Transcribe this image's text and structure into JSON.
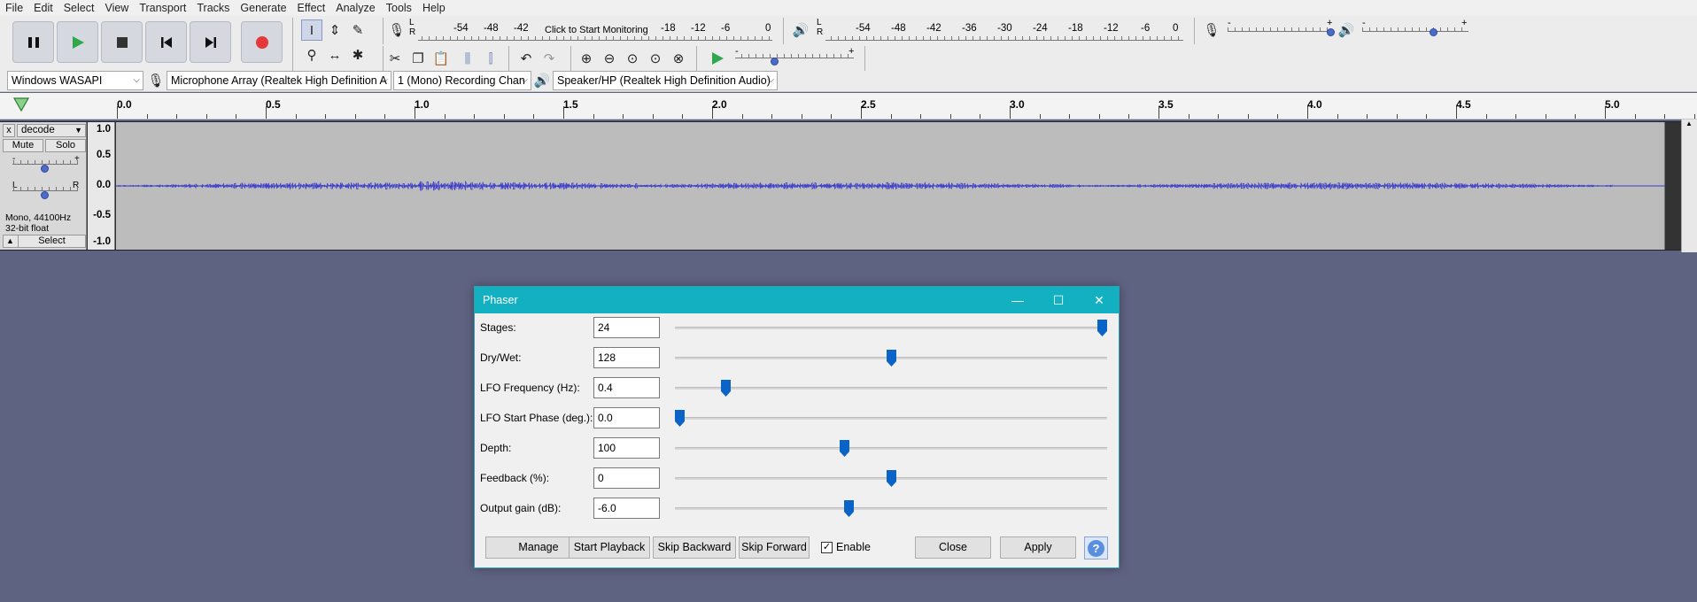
{
  "menu": [
    "File",
    "Edit",
    "Select",
    "View",
    "Transport",
    "Tracks",
    "Generate",
    "Effect",
    "Analyze",
    "Tools",
    "Help"
  ],
  "toolbar": {
    "record_meter": {
      "lr_top": "L",
      "lr_bottom": "R",
      "ticks": [
        "-54",
        "-48",
        "-42",
        "-18",
        "-12",
        "-6",
        "0"
      ],
      "monitor_label": "Click to Start Monitoring"
    },
    "playback_meter": {
      "lr_top": "L",
      "lr_bottom": "R",
      "ticks": [
        "-54",
        "-48",
        "-42",
        "-36",
        "-30",
        "-24",
        "-18",
        "-12",
        "-6",
        "0"
      ]
    },
    "mixer": {
      "minus": "-",
      "plus": "+"
    },
    "play_at_speed": {
      "minus": "-",
      "plus": "+"
    }
  },
  "device": {
    "host": "Windows WASAPI",
    "recording_device": "Microphone Array (Realtek High Definition A",
    "channels": "1 (Mono) Recording Chan",
    "playback_device": "Speaker/HP (Realtek High Definition Audio)"
  },
  "ruler": {
    "labels": [
      "0.0",
      "0.5",
      "1.0",
      "1.5",
      "2.0",
      "2.5",
      "3.0",
      "3.5",
      "4.0",
      "4.5",
      "5.0"
    ]
  },
  "track": {
    "name": "decode",
    "close": "x",
    "mute": "Mute",
    "solo": "Solo",
    "gain_minus": "-",
    "gain_plus": "+",
    "pan_left": "L",
    "pan_right": "R",
    "info_line1": "Mono, 44100Hz",
    "info_line2": "32-bit float",
    "select": "Select",
    "y_labels": [
      "1.0",
      "0.5",
      "0.0",
      "-0.5",
      "-1.0"
    ]
  },
  "dialog": {
    "title": "Phaser",
    "rows": [
      {
        "label": "Stages:",
        "value": "24",
        "level": 1.0
      },
      {
        "label": "Dry/Wet:",
        "value": "128",
        "level": 0.5
      },
      {
        "label": "LFO Frequency (Hz):",
        "value": "0.4",
        "level": 0.11
      },
      {
        "label": "LFO Start Phase (deg.):",
        "value": "0.0",
        "level": 0.0
      },
      {
        "label": "Depth:",
        "value": "100",
        "level": 0.39
      },
      {
        "label": "Feedback (%):",
        "value": "0",
        "level": 0.5
      },
      {
        "label": "Output gain (dB):",
        "value": "-6.0",
        "level": 0.4
      }
    ],
    "buttons": {
      "manage": "Manage",
      "start_playback": "Start Playback",
      "skip_backward": "Skip Backward",
      "skip_forward": "Skip Forward",
      "enable": "Enable",
      "close": "Close",
      "apply": "Apply",
      "help": "?"
    },
    "enable_checked": true
  },
  "colors": {
    "background": "#5f6382",
    "title_bar": "#12b0c0",
    "waveform": "#3c3ccc",
    "record": "#e53939",
    "play": "#2ea84a",
    "slider_thumb": "#0a64c8"
  }
}
